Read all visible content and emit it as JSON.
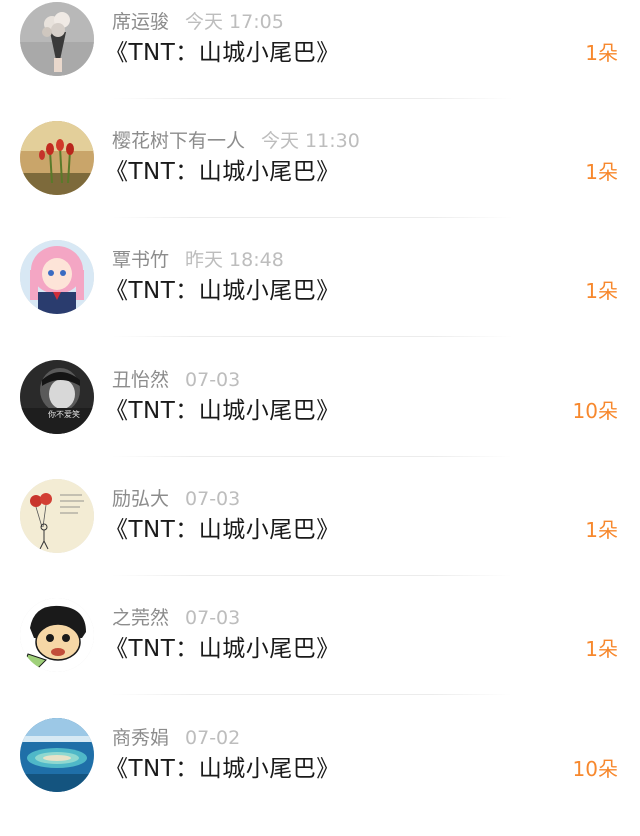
{
  "gifts": [
    {
      "name": "席运骏",
      "time": "今天 17:05",
      "title": "《TNT：山城小尾巴》",
      "count": "1朵",
      "avatar_icon": "bouquet-avatar"
    },
    {
      "name": "樱花树下有一人",
      "time": "今天 11:30",
      "title": "《TNT：山城小尾巴》",
      "count": "1朵",
      "avatar_icon": "tulips-avatar"
    },
    {
      "name": "覃书竹",
      "time": "昨天 18:48",
      "title": "《TNT：山城小尾巴》",
      "count": "1朵",
      "avatar_icon": "anime-girl-avatar"
    },
    {
      "name": "丑怡然",
      "time": "07-03",
      "title": "《TNT：山城小尾巴》",
      "count": "10朵",
      "avatar_icon": "photo-avatar",
      "avatar_caption": "你不爱笑"
    },
    {
      "name": "励弘大",
      "time": "07-03",
      "title": "《TNT：山城小尾巴》",
      "count": "1朵",
      "avatar_icon": "balloon-sketch-avatar"
    },
    {
      "name": "之莞然",
      "time": "07-03",
      "title": "《TNT：山城小尾巴》",
      "count": "1朵",
      "avatar_icon": "cartoon-face-avatar"
    },
    {
      "name": "商秀娟",
      "time": "07-02",
      "title": "《TNT：山城小尾巴》",
      "count": "10朵",
      "avatar_icon": "island-avatar"
    }
  ],
  "colors": {
    "accent": "#f7882d",
    "name": "#8c8c8c",
    "time": "#bdbdbd",
    "title": "#1a1a1a"
  }
}
